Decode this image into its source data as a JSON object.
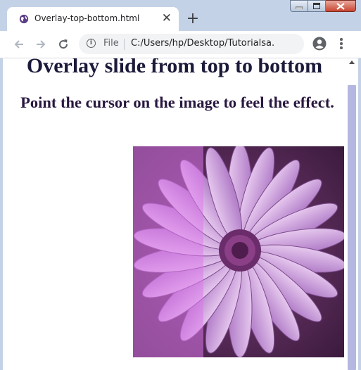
{
  "browser": {
    "tab_title": "Overlay-top-bottom.html",
    "tab_close": "✕",
    "new_tab": "+",
    "file_label": "File",
    "url": "C:/Users/hp/Desktop/Tutorialsa...",
    "icons": {
      "back": "back-arrow-icon",
      "forward": "forward-arrow-icon",
      "reload": "reload-icon",
      "info": "info-icon",
      "bookmark": "star-icon",
      "profile": "profile-icon",
      "menu": "menu-icon"
    }
  },
  "page": {
    "heading": "Overlay slide from top to bottom",
    "subheading": "Point the cursor on the image to feel the effect."
  },
  "colors": {
    "overlay": "#dc78eb",
    "heading": "#1b1a3a",
    "flower_background": "#5a2a58",
    "petal": "#c9a0d8"
  }
}
